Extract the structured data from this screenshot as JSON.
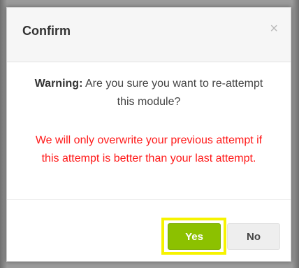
{
  "dialog": {
    "title": "Confirm",
    "close_symbol": "×",
    "warning_label": "Warning:",
    "warning_text": "Are you sure you want to re-attempt this module?",
    "note_text": "We will only overwrite your previous attempt if this attempt is better than your last attempt.",
    "buttons": {
      "yes_label": "Yes",
      "no_label": "No"
    }
  },
  "colors": {
    "note": "#ff1a1a",
    "yes_button": "#8cc100",
    "highlight": "#f6f300"
  },
  "icons": {
    "close": "close-icon"
  }
}
